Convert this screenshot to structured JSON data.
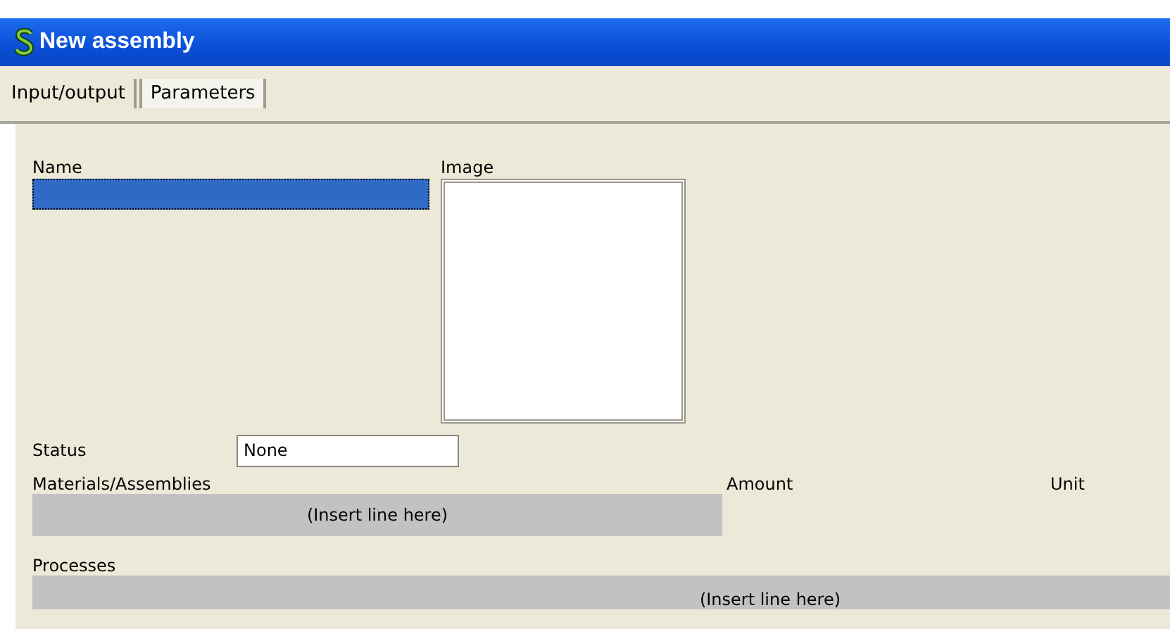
{
  "window": {
    "title": "New assembly"
  },
  "tabs": [
    {
      "label": "Input/output",
      "selected": true
    },
    {
      "label": "Parameters",
      "selected": false
    }
  ],
  "name_field": {
    "label": "Name",
    "focused": true
  },
  "image": {
    "label": "Image"
  },
  "status": {
    "label": "Status",
    "value": "None"
  },
  "materials": {
    "columns": [
      "Materials/Assemblies",
      "Amount",
      "Unit"
    ],
    "placeholder_row": "(Insert line here)"
  },
  "processes": {
    "label": "Processes",
    "placeholder_row": "(Insert line here)"
  }
}
